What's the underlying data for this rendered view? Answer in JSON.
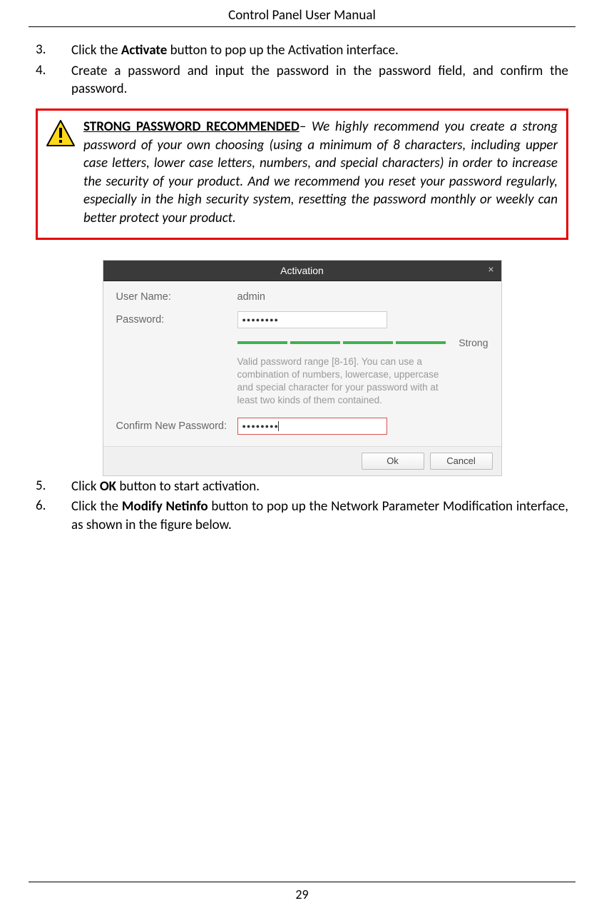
{
  "header": {
    "title": "Control Panel User Manual"
  },
  "steps": {
    "s3_num": "3.",
    "s3_pre": "Click the ",
    "s3_bold": "Activate",
    "s3_post": " button to pop up the Activation interface.",
    "s4_num": "4.",
    "s4_text": "Create a password and input the password in the password field, and confirm the password.",
    "s5_num": "5.",
    "s5_pre": "Click ",
    "s5_bold": "OK",
    "s5_post": " button to start activation.",
    "s6_num": "6.",
    "s6_pre": "Click the ",
    "s6_bold": "Modify Netinfo",
    "s6_post": " button to pop up the Network Parameter Modification interface, as shown in the figure below."
  },
  "callout": {
    "title": "STRONG PASSWORD RECOMMENDED",
    "dash": "– ",
    "body": "We highly recommend you create a strong password of your own choosing (using a minimum of 8 characters, including upper case letters, lower case letters, numbers, and special characters) in order to increase the security of your product. And we recommend you reset your password regularly, especially in the high security system, resetting the password monthly or weekly can better protect your product."
  },
  "dialog": {
    "title": "Activation",
    "username_label": "User Name:",
    "username_value": "admin",
    "password_label": "Password:",
    "password_value": "●●●●●●●●",
    "strength_label": "Strong",
    "hint": "Valid password range [8-16]. You can use a combination of numbers, lowercase, uppercase and special character for your password with at least two kinds of them contained.",
    "confirm_label": "Confirm New Password:",
    "confirm_value": "●●●●●●●●",
    "ok": "Ok",
    "cancel": "Cancel"
  },
  "footer": {
    "page": "29"
  }
}
